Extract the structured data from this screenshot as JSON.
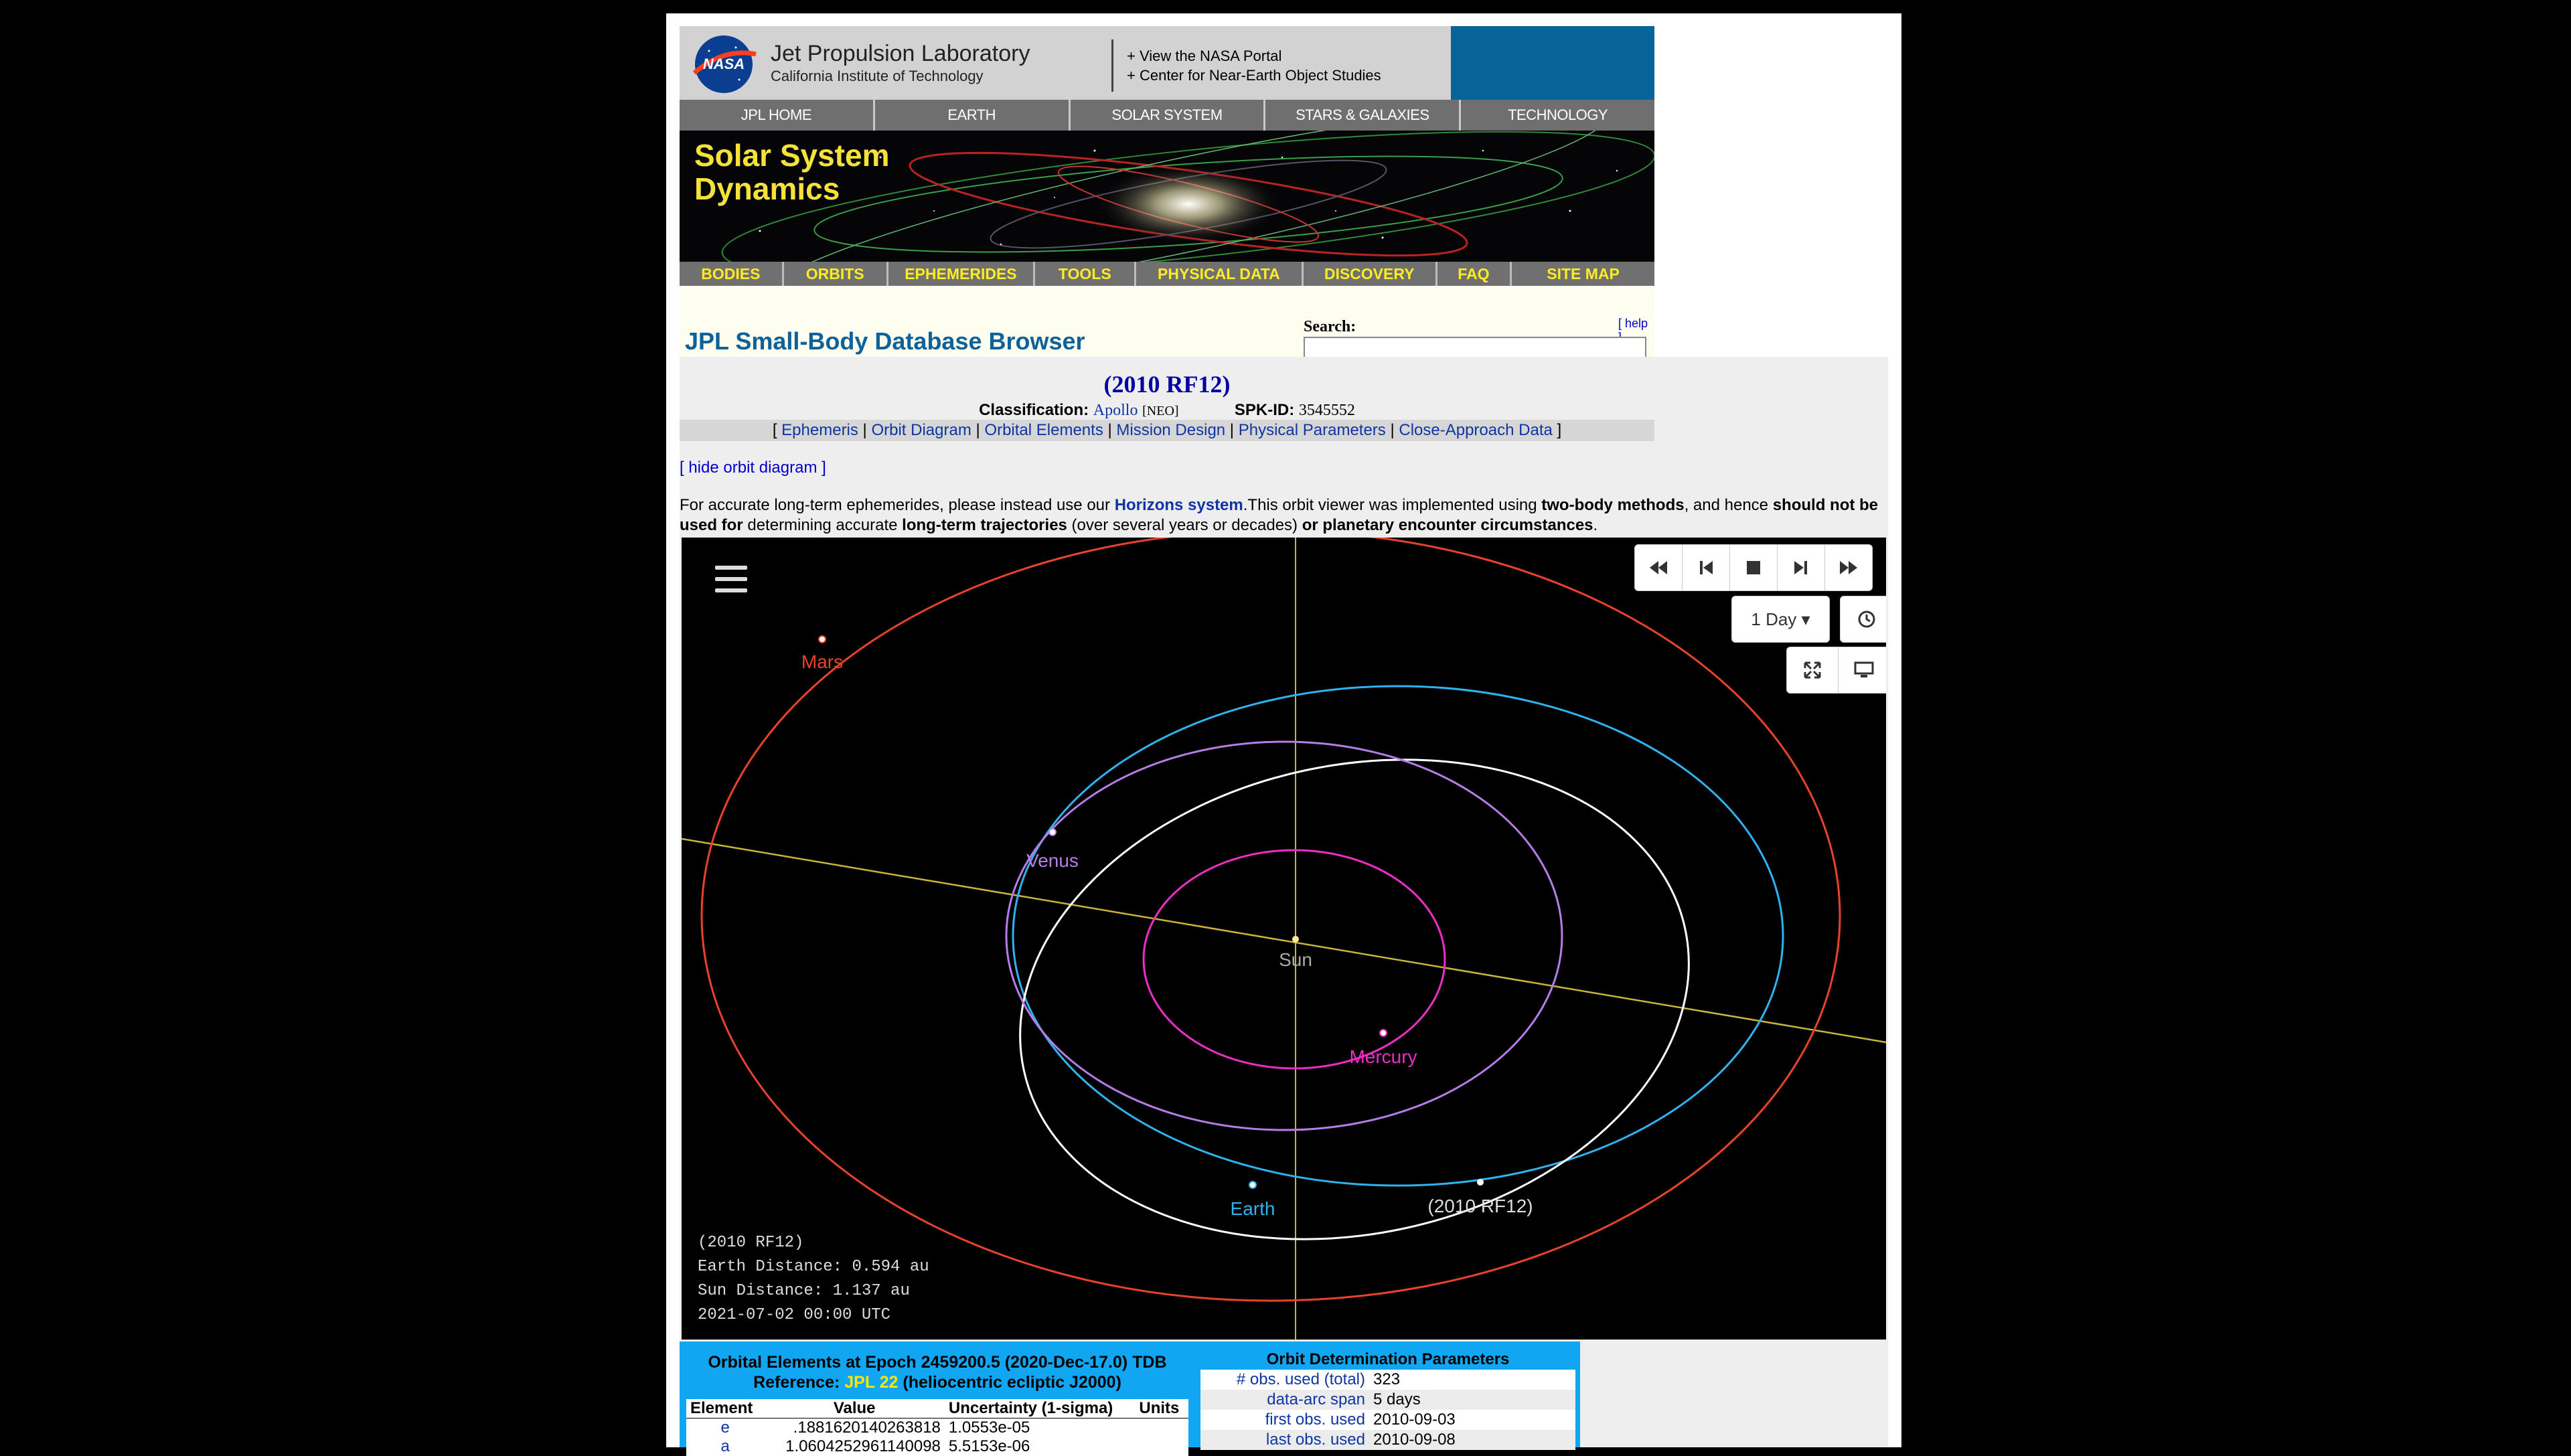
{
  "header": {
    "org_name": "Jet Propulsion Laboratory",
    "org_sub": "California Institute of Technology",
    "portal_links": [
      "+ View the NASA Portal",
      "+ Center for Near-Earth Object Studies"
    ]
  },
  "top_nav": [
    "JPL HOME",
    "EARTH",
    "SOLAR SYSTEM",
    "STARS & GALAXIES",
    "TECHNOLOGY"
  ],
  "banner": {
    "title_line1": "Solar System",
    "title_line2": "Dynamics"
  },
  "ssd_nav": [
    "BODIES",
    "ORBITS",
    "EPHEMERIDES",
    "TOOLS",
    "PHYSICAL DATA",
    "DISCOVERY",
    "FAQ",
    "SITE MAP"
  ],
  "browser": {
    "title": "JPL Small-Body Database Browser",
    "search_label": "Search:",
    "help_label": "[ help ]",
    "search_value": ""
  },
  "object": {
    "name": "(2010 RF12)",
    "classification_label": "Classification:",
    "classification_value": "Apollo",
    "classification_tag": "[NEO]",
    "spk_label": "SPK-ID:",
    "spk_value": "3545552",
    "links": [
      "Ephemeris",
      "Orbit Diagram",
      "Orbital Elements",
      "Mission Design",
      "Physical Parameters",
      "Close-Approach Data"
    ]
  },
  "hide_orbit_label": "[ hide orbit diagram ]",
  "notice": {
    "part1": "For accurate long-term ephemerides, please instead use our ",
    "link": "Horizons system",
    "part2": ".This orbit viewer was implemented using ",
    "b1": "two-body methods",
    "part3": ", and hence ",
    "b2": "should not be used for",
    "part4": " determining accurate ",
    "b3": "long-term trajectories",
    "part5": " (over several years or decades) ",
    "b4": "or planetary encounter circumstances",
    "part6": "."
  },
  "viewer": {
    "speed": "1 Day ▾",
    "labels": {
      "mars": "Mars",
      "venus": "Venus",
      "sun": "Sun",
      "mercury": "Mercury",
      "earth": "Earth",
      "asteroid": "(2010 RF12)"
    },
    "readout": {
      "name": "(2010 RF12)",
      "earth_distance": "Earth Distance: 0.594 au",
      "sun_distance": "Sun Distance: 1.137 au",
      "date": "2021-07-02 00:00 UTC"
    },
    "colors": {
      "mars": "#e8432a",
      "venus": "#b47ee6",
      "mercury": "#ec2ec4",
      "earth": "#2fb3f0",
      "asteroid": "#ffffff",
      "axis": "#c9b53c"
    }
  },
  "elements": {
    "title": "Orbital Elements at Epoch 2459200.5 (2020-Dec-17.0) TDB",
    "ref_prefix": "Reference: ",
    "ref_link": "JPL 22",
    "ref_suffix": " (heliocentric ecliptic J2000)",
    "headers": [
      "Element",
      "Value",
      "Uncertainty (1-sigma)",
      "Units"
    ],
    "rows": [
      [
        "e",
        ".1881620140263818",
        "1.0553e-05",
        ""
      ],
      [
        "a",
        "1.0604252961140098",
        "5.5153e-06",
        ""
      ]
    ]
  },
  "od": {
    "title": "Orbit Determination Parameters",
    "rows": [
      [
        "# obs. used (total)",
        "323"
      ],
      [
        "data-arc span",
        "5 days"
      ],
      [
        "first obs. used",
        "2010-09-03"
      ],
      [
        "last obs. used",
        "2010-09-08"
      ]
    ]
  }
}
